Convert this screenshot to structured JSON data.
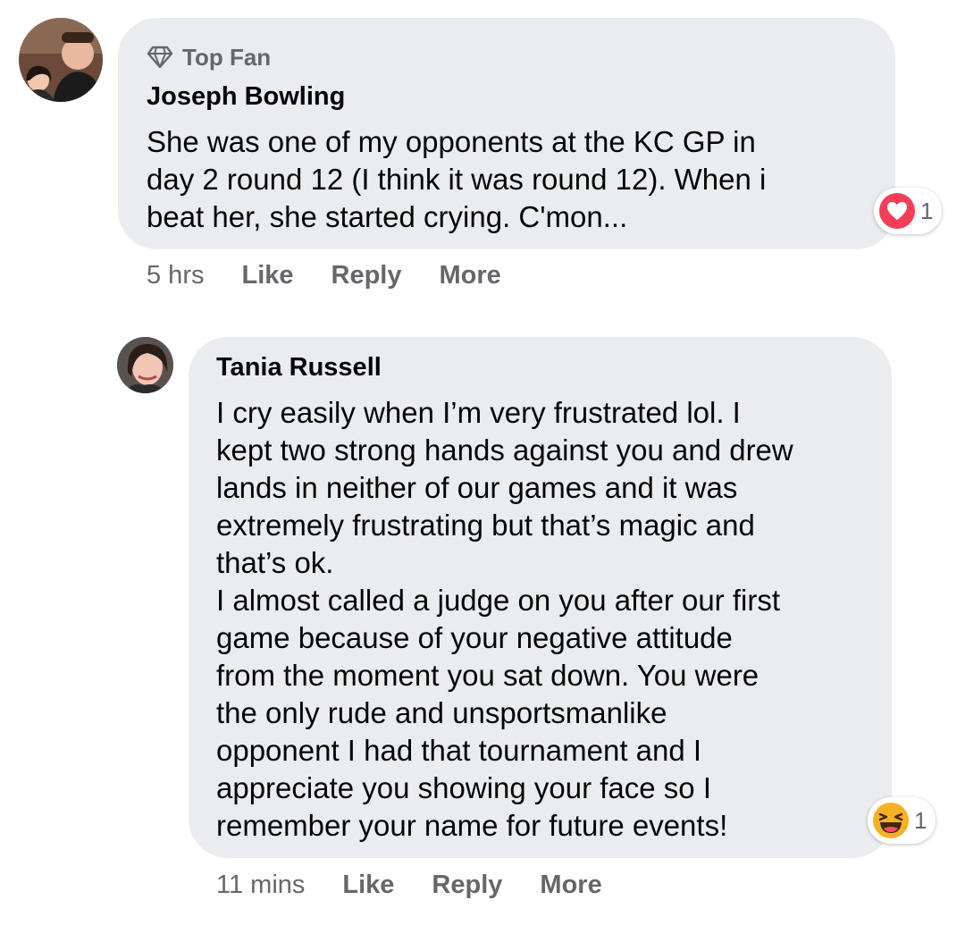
{
  "comments": [
    {
      "badge": "Top Fan",
      "badge_icon": "diamond-icon",
      "author": "Joseph Bowling",
      "text": "She was one of my opponents at the KC GP in\nday 2 round 12 (I think it was round 12). When i\nbeat her, she started crying. C'mon...",
      "time": "5 hrs",
      "actions": [
        "Like",
        "Reply",
        "More"
      ],
      "reaction": {
        "icon": "heart-love-icon",
        "count": "1",
        "color": "#f33e58"
      }
    },
    {
      "author": "Tania Russell",
      "text": "I cry easily when I’m very frustrated lol. I\nkept two strong hands against you and drew\nlands in neither of our games and it was\nextremely frustrating but that’s magic and\nthat’s ok.\nI almost called a judge on you after our first\ngame because of your negative attitude\nfrom the moment you sat down. You were\nthe only rude and unsportsmanlike\nopponent I had that tournament and I\nappreciate you showing your face so I\nremember your name for future events!",
      "time": "11 mins",
      "actions": [
        "Like",
        "Reply",
        "More"
      ],
      "reaction": {
        "icon": "laughing-haha-icon",
        "count": "1",
        "color": "#f7b125"
      }
    }
  ]
}
